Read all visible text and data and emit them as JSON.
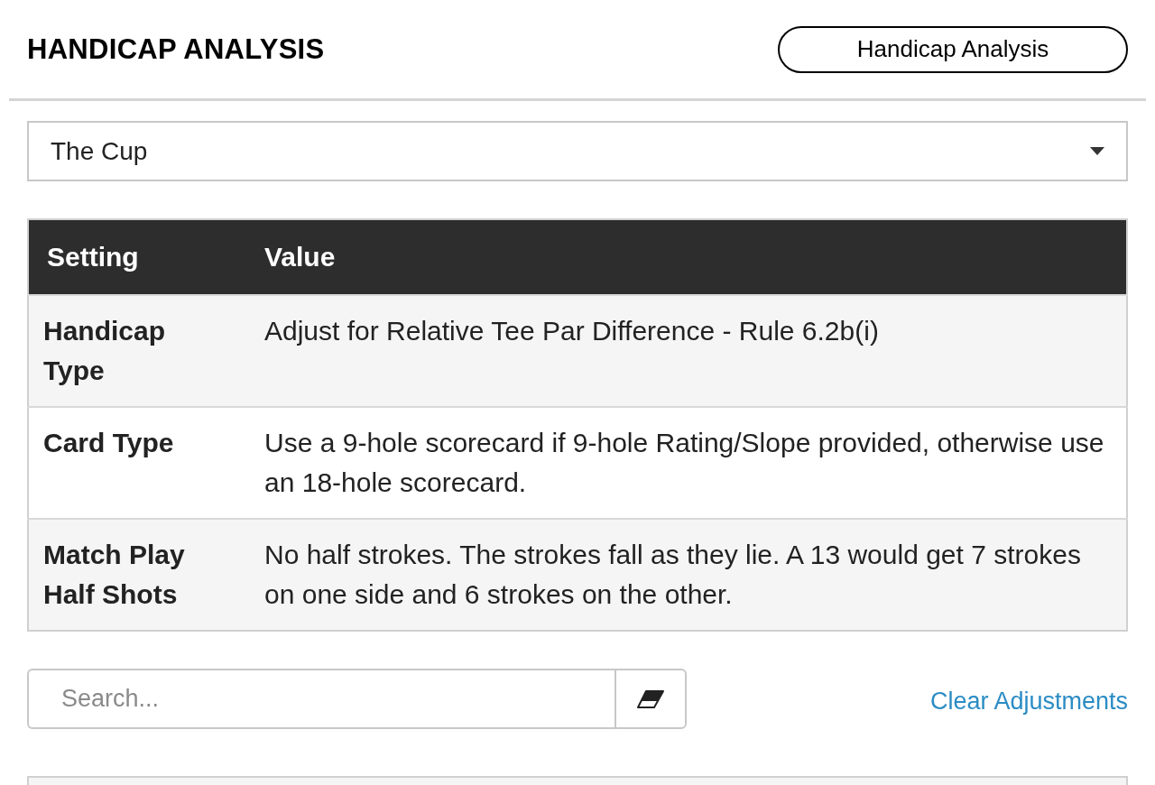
{
  "header": {
    "title": "HANDICAP ANALYSIS",
    "button": "Handicap Analysis"
  },
  "competition_select": {
    "value": "The Cup"
  },
  "settings_table": {
    "columns": [
      "Setting",
      "Value"
    ],
    "rows": [
      {
        "setting": "Handicap Type",
        "value": "Adjust for Relative Tee Par Difference - Rule 6.2b(i)"
      },
      {
        "setting": "Card Type",
        "value": "Use a 9-hole scorecard if 9-hole Rating/Slope provided, otherwise use an 18-hole scorecard."
      },
      {
        "setting": "Match Play Half Shots",
        "value": "No half strokes. The strokes fall as they lie. A 13 would get 7 strokes on one side and 6 strokes on the other."
      }
    ]
  },
  "search": {
    "placeholder": "Search..."
  },
  "clear_link": "Clear Adjustments"
}
